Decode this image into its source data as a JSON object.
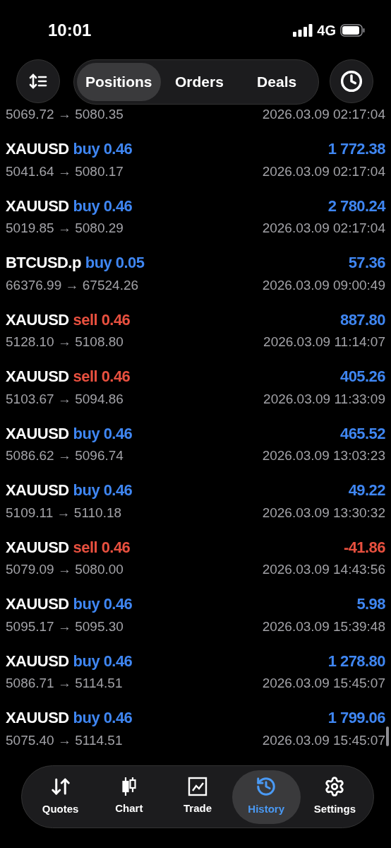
{
  "status_bar": {
    "time": "10:01",
    "network": "4G"
  },
  "segments": [
    {
      "label": "Positions",
      "selected": true
    },
    {
      "label": "Orders",
      "selected": false
    },
    {
      "label": "Deals",
      "selected": false
    }
  ],
  "deals": [
    {
      "prices": "5069.72 → 5080.35",
      "time": "2026.03.09 02:17:04"
    },
    {
      "symbol": "XAUUSD",
      "side": "buy 0.46",
      "kind": "buy",
      "profit": "1 772.38",
      "loss": false,
      "prices": "5041.64 → 5080.17",
      "time": "2026.03.09 02:17:04"
    },
    {
      "symbol": "XAUUSD",
      "side": "buy 0.46",
      "kind": "buy",
      "profit": "2 780.24",
      "loss": false,
      "prices": "5019.85 → 5080.29",
      "time": "2026.03.09 02:17:04"
    },
    {
      "symbol": "BTCUSD.p",
      "side": "buy 0.05",
      "kind": "buy",
      "profit": "57.36",
      "loss": false,
      "prices": "66376.99 → 67524.26",
      "time": "2026.03.09 09:00:49"
    },
    {
      "symbol": "XAUUSD",
      "side": "sell 0.46",
      "kind": "sell",
      "profit": "887.80",
      "loss": false,
      "prices": "5128.10 → 5108.80",
      "time": "2026.03.09 11:14:07"
    },
    {
      "symbol": "XAUUSD",
      "side": "sell 0.46",
      "kind": "sell",
      "profit": "405.26",
      "loss": false,
      "prices": "5103.67 → 5094.86",
      "time": "2026.03.09 11:33:09"
    },
    {
      "symbol": "XAUUSD",
      "side": "buy 0.46",
      "kind": "buy",
      "profit": "465.52",
      "loss": false,
      "prices": "5086.62 → 5096.74",
      "time": "2026.03.09 13:03:23"
    },
    {
      "symbol": "XAUUSD",
      "side": "buy 0.46",
      "kind": "buy",
      "profit": "49.22",
      "loss": false,
      "prices": "5109.11 → 5110.18",
      "time": "2026.03.09 13:30:32"
    },
    {
      "symbol": "XAUUSD",
      "side": "sell 0.46",
      "kind": "sell",
      "profit": "-41.86",
      "loss": true,
      "prices": "5079.09 → 5080.00",
      "time": "2026.03.09 14:43:56"
    },
    {
      "symbol": "XAUUSD",
      "side": "buy 0.46",
      "kind": "buy",
      "profit": "5.98",
      "loss": false,
      "prices": "5095.17 → 5095.30",
      "time": "2026.03.09 15:39:48"
    },
    {
      "symbol": "XAUUSD",
      "side": "buy 0.46",
      "kind": "buy",
      "profit": "1 278.80",
      "loss": false,
      "prices": "5086.71 → 5114.51",
      "time": "2026.03.09 15:45:07"
    },
    {
      "symbol": "XAUUSD",
      "side": "buy 0.46",
      "kind": "buy",
      "profit": "1 799.06",
      "loss": false,
      "prices": "5075.40 → 5114.51",
      "time": "2026.03.09 15:45:07"
    }
  ],
  "tab_bar": [
    {
      "label": "Quotes",
      "selected": false
    },
    {
      "label": "Chart",
      "selected": false
    },
    {
      "label": "Trade",
      "selected": false
    },
    {
      "label": "History",
      "selected": true
    },
    {
      "label": "Settings",
      "selected": false
    }
  ]
}
